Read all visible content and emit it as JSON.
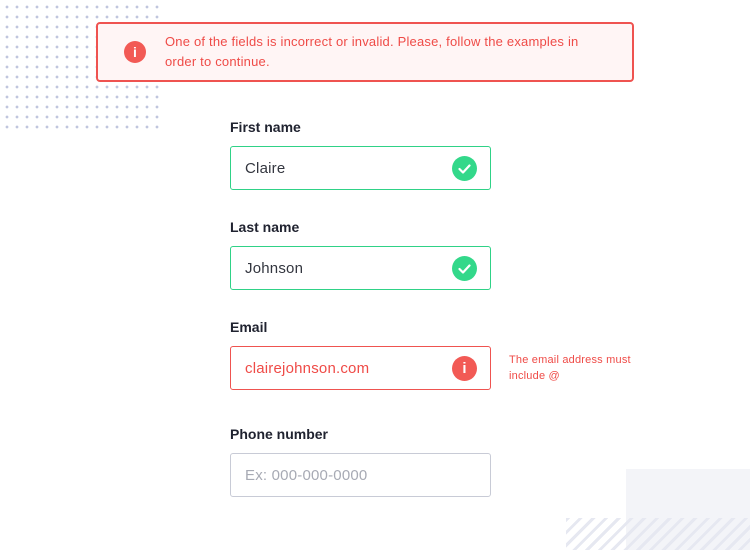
{
  "banner": {
    "icon": "alert-circle-icon",
    "message": "One of the fields is incorrect or invalid. Please, follow the examples in order to continue."
  },
  "form": {
    "first_name": {
      "label": "First name",
      "value": "Claire",
      "status": "valid",
      "icon": "check-circle-icon"
    },
    "last_name": {
      "label": "Last name",
      "value": "Johnson",
      "status": "valid",
      "icon": "check-circle-icon"
    },
    "email": {
      "label": "Email",
      "value": "clairejohnson.com",
      "status": "invalid",
      "icon": "alert-circle-icon",
      "error": "The email address must include @"
    },
    "phone": {
      "label": "Phone number",
      "value": "",
      "placeholder": "Ex: 000-000-0000"
    }
  },
  "colors": {
    "valid": "#33d88a",
    "error": "#f25a55",
    "text": "#202330",
    "placeholder": "#a7aab4"
  }
}
